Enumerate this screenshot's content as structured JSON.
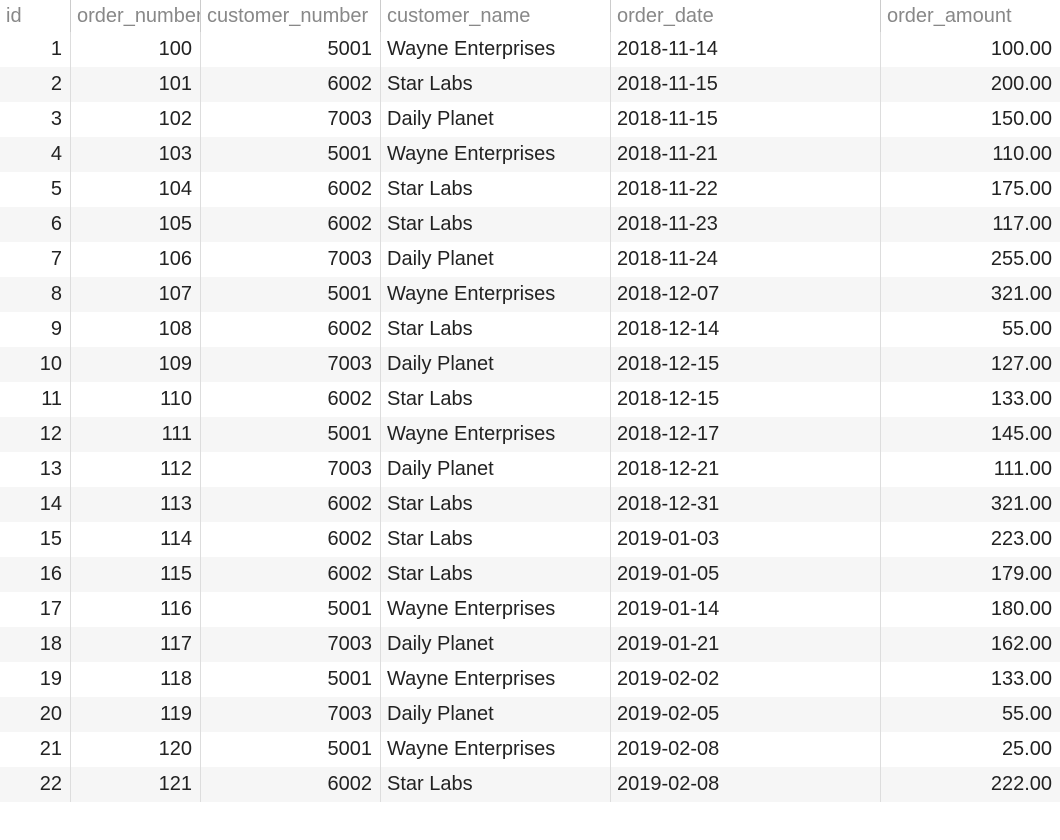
{
  "columns": {
    "id": "id",
    "order_number": "order_number",
    "customer_number": "customer_number",
    "customer_name": "customer_name",
    "order_date": "order_date",
    "order_amount": "order_amount"
  },
  "rows": [
    {
      "id": "1",
      "order_number": "100",
      "customer_number": "5001",
      "customer_name": "Wayne Enterprises",
      "order_date": "2018-11-14",
      "order_amount": "100.00"
    },
    {
      "id": "2",
      "order_number": "101",
      "customer_number": "6002",
      "customer_name": "Star Labs",
      "order_date": "2018-11-15",
      "order_amount": "200.00"
    },
    {
      "id": "3",
      "order_number": "102",
      "customer_number": "7003",
      "customer_name": "Daily Planet",
      "order_date": "2018-11-15",
      "order_amount": "150.00"
    },
    {
      "id": "4",
      "order_number": "103",
      "customer_number": "5001",
      "customer_name": "Wayne Enterprises",
      "order_date": "2018-11-21",
      "order_amount": "110.00"
    },
    {
      "id": "5",
      "order_number": "104",
      "customer_number": "6002",
      "customer_name": "Star Labs",
      "order_date": "2018-11-22",
      "order_amount": "175.00"
    },
    {
      "id": "6",
      "order_number": "105",
      "customer_number": "6002",
      "customer_name": "Star Labs",
      "order_date": "2018-11-23",
      "order_amount": "117.00"
    },
    {
      "id": "7",
      "order_number": "106",
      "customer_number": "7003",
      "customer_name": "Daily Planet",
      "order_date": "2018-11-24",
      "order_amount": "255.00"
    },
    {
      "id": "8",
      "order_number": "107",
      "customer_number": "5001",
      "customer_name": "Wayne Enterprises",
      "order_date": "2018-12-07",
      "order_amount": "321.00"
    },
    {
      "id": "9",
      "order_number": "108",
      "customer_number": "6002",
      "customer_name": "Star Labs",
      "order_date": "2018-12-14",
      "order_amount": "55.00"
    },
    {
      "id": "10",
      "order_number": "109",
      "customer_number": "7003",
      "customer_name": "Daily Planet",
      "order_date": "2018-12-15",
      "order_amount": "127.00"
    },
    {
      "id": "11",
      "order_number": "110",
      "customer_number": "6002",
      "customer_name": "Star Labs",
      "order_date": "2018-12-15",
      "order_amount": "133.00"
    },
    {
      "id": "12",
      "order_number": "111",
      "customer_number": "5001",
      "customer_name": "Wayne Enterprises",
      "order_date": "2018-12-17",
      "order_amount": "145.00"
    },
    {
      "id": "13",
      "order_number": "112",
      "customer_number": "7003",
      "customer_name": "Daily Planet",
      "order_date": "2018-12-21",
      "order_amount": "111.00"
    },
    {
      "id": "14",
      "order_number": "113",
      "customer_number": "6002",
      "customer_name": "Star Labs",
      "order_date": "2018-12-31",
      "order_amount": "321.00"
    },
    {
      "id": "15",
      "order_number": "114",
      "customer_number": "6002",
      "customer_name": "Star Labs",
      "order_date": "2019-01-03",
      "order_amount": "223.00"
    },
    {
      "id": "16",
      "order_number": "115",
      "customer_number": "6002",
      "customer_name": "Star Labs",
      "order_date": "2019-01-05",
      "order_amount": "179.00"
    },
    {
      "id": "17",
      "order_number": "116",
      "customer_number": "5001",
      "customer_name": "Wayne Enterprises",
      "order_date": "2019-01-14",
      "order_amount": "180.00"
    },
    {
      "id": "18",
      "order_number": "117",
      "customer_number": "7003",
      "customer_name": "Daily Planet",
      "order_date": "2019-01-21",
      "order_amount": "162.00"
    },
    {
      "id": "19",
      "order_number": "118",
      "customer_number": "5001",
      "customer_name": "Wayne Enterprises",
      "order_date": "2019-02-02",
      "order_amount": "133.00"
    },
    {
      "id": "20",
      "order_number": "119",
      "customer_number": "7003",
      "customer_name": "Daily Planet",
      "order_date": "2019-02-05",
      "order_amount": "55.00"
    },
    {
      "id": "21",
      "order_number": "120",
      "customer_number": "5001",
      "customer_name": "Wayne Enterprises",
      "order_date": "2019-02-08",
      "order_amount": "25.00"
    },
    {
      "id": "22",
      "order_number": "121",
      "customer_number": "6002",
      "customer_name": "Star Labs",
      "order_date": "2019-02-08",
      "order_amount": "222.00"
    }
  ]
}
